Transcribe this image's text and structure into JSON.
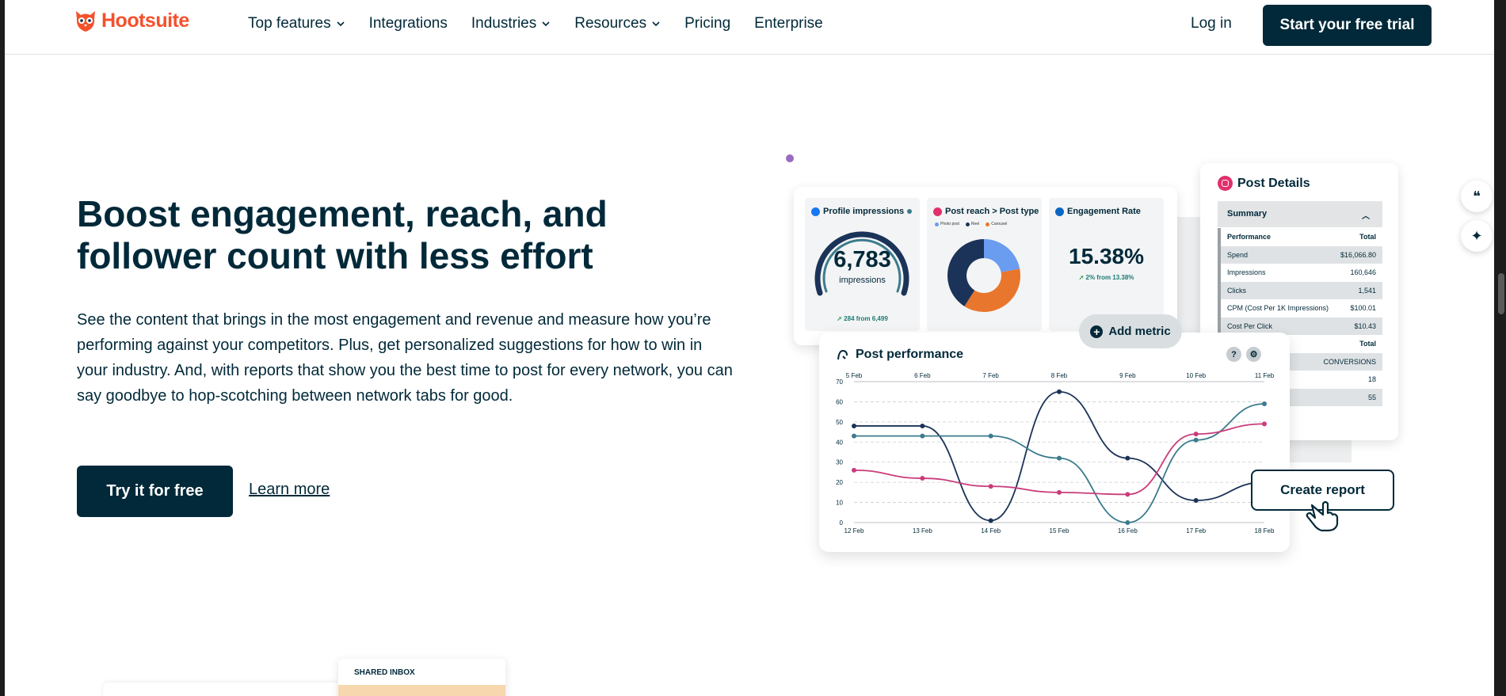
{
  "nav": {
    "brand": "Hootsuite",
    "links": [
      {
        "label": "Top features",
        "dropdown": true
      },
      {
        "label": "Integrations",
        "dropdown": false
      },
      {
        "label": "Industries",
        "dropdown": true
      },
      {
        "label": "Resources",
        "dropdown": true
      },
      {
        "label": "Pricing",
        "dropdown": false
      },
      {
        "label": "Enterprise",
        "dropdown": false
      }
    ],
    "login": "Log in",
    "trial": "Start your free trial"
  },
  "hero": {
    "title_line1": "Boost engagement, reach, and",
    "title_line2": "follower count with less effort",
    "body": "See the content that brings in the most engagement and revenue and measure how you’re performing against your competitors. Plus, get personalized suggestions for how to win in your industry. And, with reports that show you the best time to post for every network, you can say goodbye to hop-scotching between network tabs for good.",
    "cta_primary": "Try it for free",
    "cta_link": "Learn more"
  },
  "metrics": {
    "impressions": {
      "title": "Profile impressions",
      "value": "6,783",
      "unit": "impressions",
      "growth": "284 from 6,499"
    },
    "reach": {
      "title": "Post reach > Post type",
      "legend": [
        "Photo post",
        "Reel",
        "Carousel"
      ],
      "shares": [
        0.22,
        0.37,
        0.41
      ]
    },
    "engagement": {
      "title": "Engagement Rate",
      "value": "15.38%",
      "growth": "2% from 13.38%"
    }
  },
  "details": {
    "title": "Post Details",
    "summary": "Summary",
    "header": [
      "Performance",
      "Total"
    ],
    "rows": [
      [
        "Spend",
        "$16,066.80"
      ],
      [
        "Impressions",
        "160,646"
      ],
      [
        "Clicks",
        "1,541"
      ],
      [
        "CPM (Cost Per 1K Impressions)",
        "$100.01"
      ],
      [
        "Cost Per Click",
        "$10.43"
      ]
    ],
    "header2": "Total",
    "rows2": [
      [
        "",
        "CONVERSIONS"
      ],
      [
        "",
        "18"
      ],
      [
        "",
        "55"
      ]
    ]
  },
  "add_metric": "Add metric",
  "create_report": "Create report",
  "inbox_label": "SHARED INBOX",
  "colors": {
    "brand": "#012939",
    "accent": "#f4512c",
    "navy": "#1b3358",
    "teal": "#3b7b8c",
    "pink": "#c93c7a",
    "orange": "#e8762c",
    "blue": "#6a9cf0"
  },
  "chart_data": {
    "type": "line",
    "title": "Post performance",
    "x_top": [
      "5 Feb",
      "6 Feb",
      "7 Feb",
      "8 Feb",
      "9 Feb",
      "10 Feb",
      "11 Feb"
    ],
    "x": [
      "12 Feb",
      "13 Feb",
      "14 Feb",
      "15 Feb",
      "16 Feb",
      "17 Feb",
      "18 Feb"
    ],
    "ylim": [
      0,
      70
    ],
    "yticks": [
      0,
      10,
      20,
      30,
      40,
      50,
      60,
      70
    ],
    "series": [
      {
        "color": "#1b3358",
        "values": [
          48,
          48,
          1,
          65,
          32,
          11,
          20
        ]
      },
      {
        "color": "#3b7b8c",
        "values": [
          43,
          43,
          43,
          32,
          0,
          41,
          59
        ]
      },
      {
        "color": "#c93c7a",
        "values": [
          26,
          22,
          18,
          15,
          14,
          44,
          49
        ]
      }
    ]
  }
}
